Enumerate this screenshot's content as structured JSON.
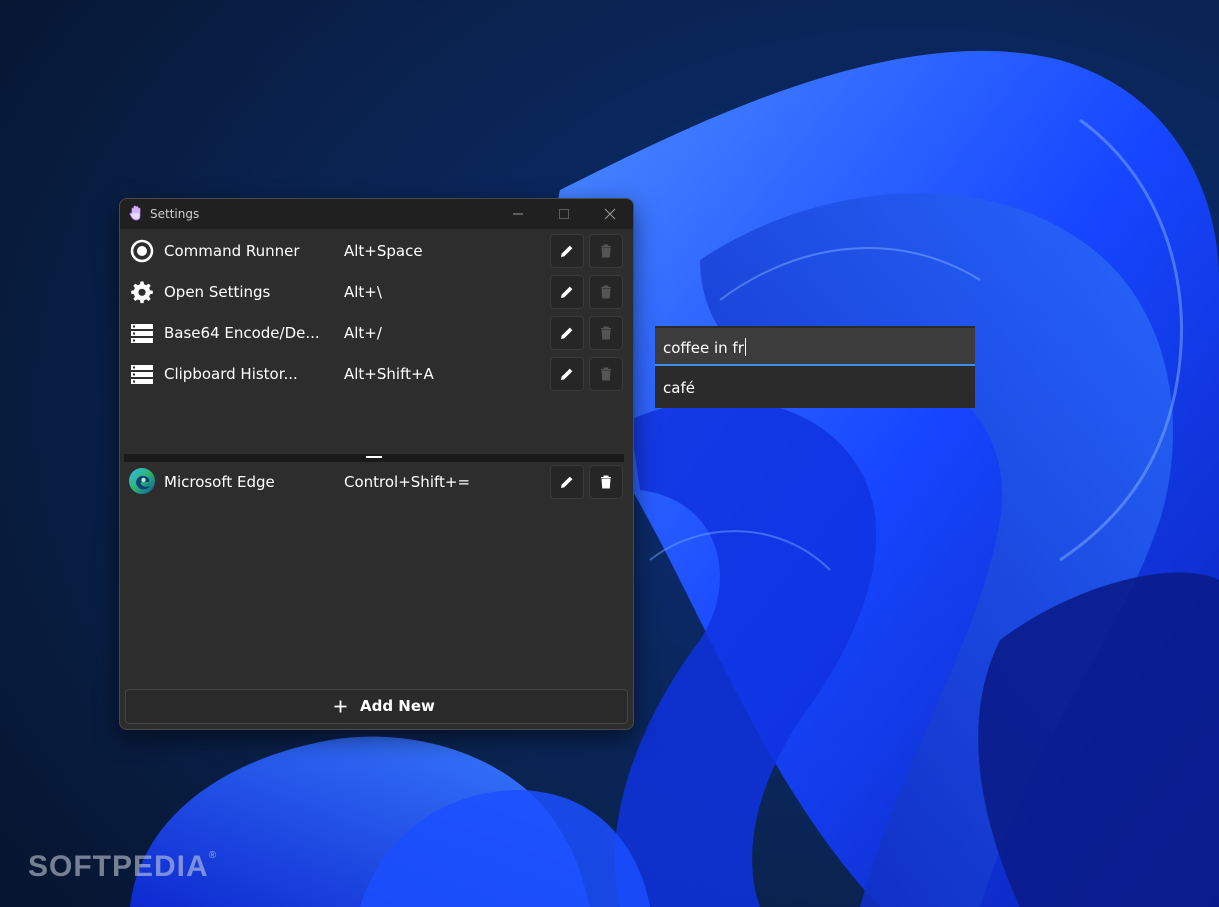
{
  "window": {
    "title": "Settings",
    "bindings": [
      {
        "name": "Command Runner",
        "shortcut": "Alt+Space",
        "icon": "record-circle-icon",
        "deletable": false
      },
      {
        "name": "Open Settings",
        "shortcut": "Alt+\\",
        "icon": "gear-icon",
        "deletable": false
      },
      {
        "name": "Base64 Encode/De...",
        "shortcut": "Alt+/",
        "icon": "list-icon",
        "deletable": false
      },
      {
        "name": "Clipboard Histor...",
        "shortcut": "Alt+Shift+A",
        "icon": "list-icon",
        "deletable": false
      }
    ],
    "apps": [
      {
        "name": "Microsoft Edge",
        "shortcut": "Control+Shift+=",
        "icon": "edge-logo-icon",
        "deletable": true
      }
    ],
    "add_label": "Add New"
  },
  "runner": {
    "query": "coffee in fr",
    "result": "café"
  },
  "watermark": "SOFTPEDIA",
  "colors": {
    "window_bg": "#2d2d2d",
    "titlebar_bg": "#202020",
    "accent": "#3d8ee8",
    "wallpaper_blue": "#1d4fff"
  }
}
